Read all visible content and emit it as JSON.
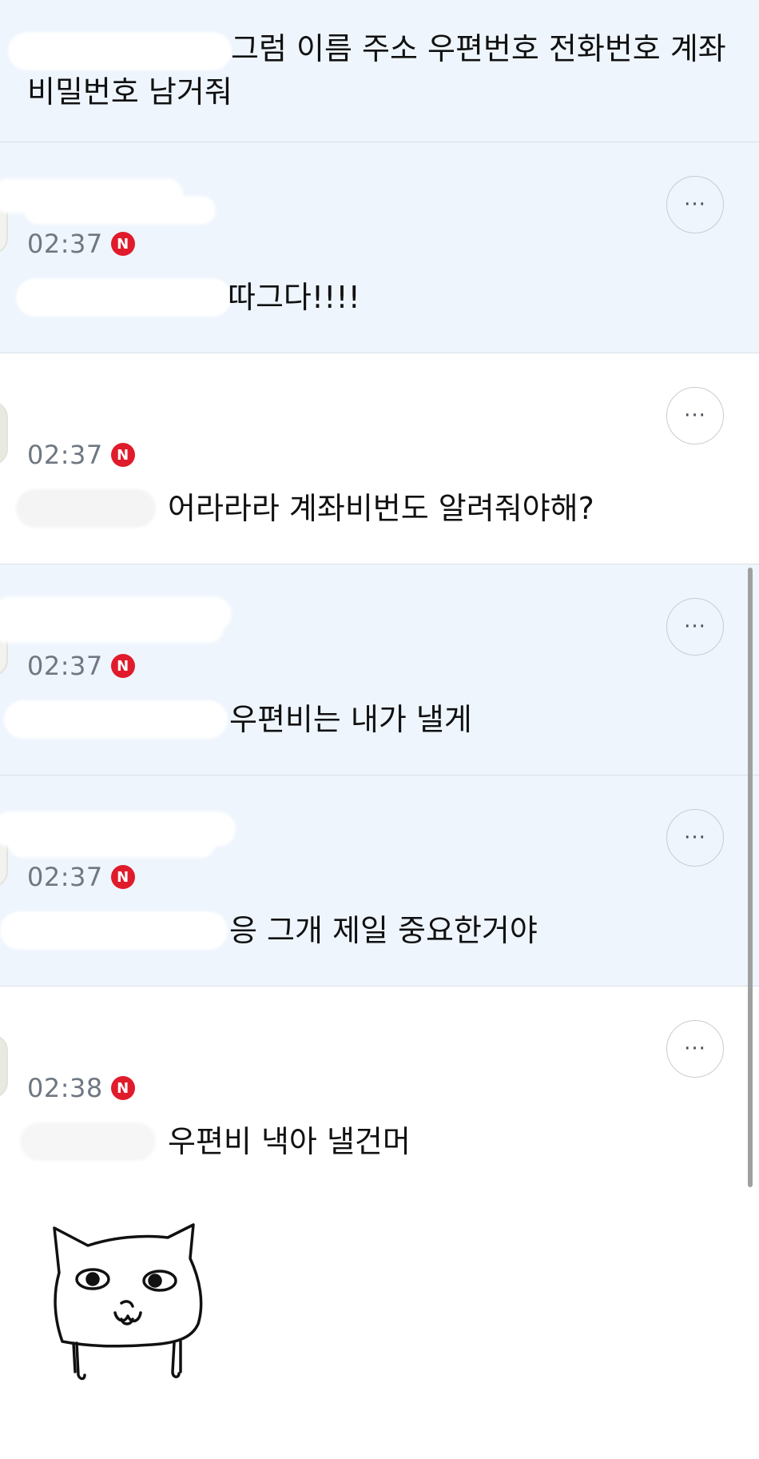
{
  "comments": [
    {
      "text": "그럼 이름 주소 우편번호 전화번호 계좌비밀번호 남거줘"
    },
    {
      "time": "02:37",
      "badge": "N",
      "text": "따그다!!!!",
      "more": "···"
    },
    {
      "time": "02:37",
      "badge": "N",
      "text": "어라라라 계좌비번도 알려줘야해?",
      "more": "···"
    },
    {
      "time": "02:37",
      "badge": "N",
      "text": "우편비는 내가 낼게",
      "more": "···"
    },
    {
      "time": "02:37",
      "badge": "N",
      "text": "응 그개 제일 중요한거야",
      "more": "···"
    },
    {
      "time": "02:38",
      "badge": "N",
      "text": "우편비 낵아 낼건머",
      "more": "···"
    }
  ],
  "colors": {
    "highlight_bg": "#eef5fd",
    "badge_red": "#e01b2b",
    "time_gray": "#6f7782"
  }
}
